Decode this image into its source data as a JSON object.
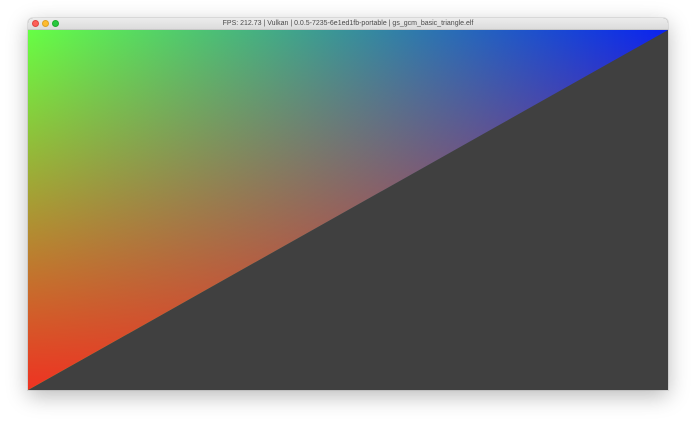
{
  "window": {
    "title": "FPS: 212.73 | Vulkan | 0.0.5-7235-6e1ed1fb-portable | gs_gcm_basic_triangle.elf",
    "controls": {
      "close": "close-button",
      "minimize": "minimize-button",
      "zoom": "zoom-button"
    }
  },
  "viewport": {
    "clear_color": "#404040",
    "triangle": {
      "vertex_colors": {
        "top_left": "#66ff44",
        "top_right": "#0a22f0",
        "bottom_left": "#ee3322"
      }
    }
  }
}
